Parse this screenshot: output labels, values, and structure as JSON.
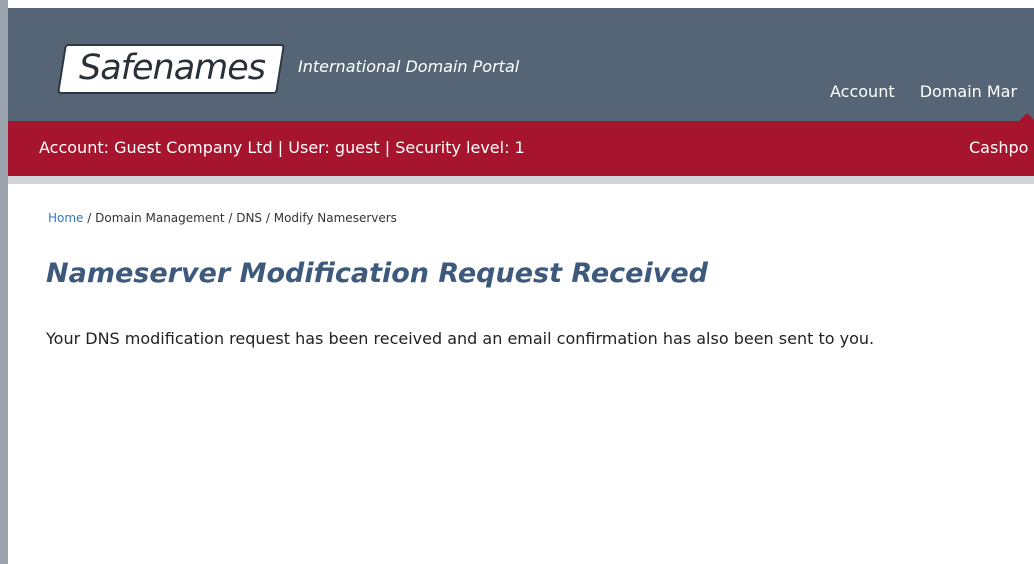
{
  "header": {
    "logo_text": "Safenames",
    "tagline": "International Domain Portal",
    "nav": [
      {
        "label": "Account"
      },
      {
        "label": "Domain Mar"
      }
    ]
  },
  "account_bar": {
    "info": "Account: Guest Company Ltd | User: guest | Security level: 1",
    "right": "Cashpo"
  },
  "breadcrumb": {
    "home": "Home",
    "separator": " / ",
    "rest": "Domain Management / DNS / Modify Nameservers"
  },
  "main": {
    "title": "Nameserver Modification Request Received",
    "message": "Your DNS modification request has been received and an email confirmation has also been sent to you."
  }
}
